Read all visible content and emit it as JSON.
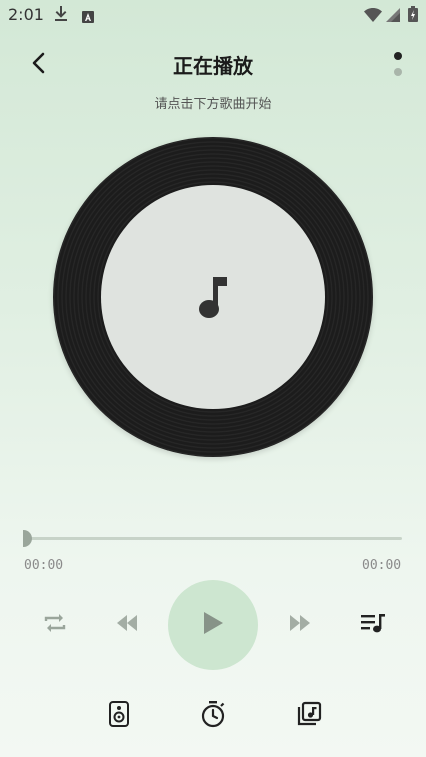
{
  "status_bar": {
    "time": "2:01",
    "icons": [
      "download-icon",
      "a-icon",
      "wifi-icon",
      "signal-icon",
      "battery-icon"
    ]
  },
  "header": {
    "title": "正在播放",
    "back_icon": "chevron-left-icon",
    "page_indicator": {
      "count": 2,
      "active_index": 0
    }
  },
  "subtitle": "请点击下方歌曲开始",
  "player": {
    "cover_icon": "music-note-icon",
    "progress": 0,
    "current_time": "00:00",
    "total_time": "00:00"
  },
  "controls": {
    "repeat_icon": "repeat-icon",
    "rewind_icon": "rewind-icon",
    "play_icon": "play-icon",
    "forward_icon": "fast-forward-icon",
    "playlist_icon": "playlist-icon"
  },
  "bottom_actions": {
    "speaker_icon": "speaker-icon",
    "timer_icon": "timer-icon",
    "library_icon": "music-library-icon"
  },
  "colors": {
    "background_top": "#d3e8d6",
    "background_bottom": "#f3f8f3",
    "play_button_bg": "#cde6d0",
    "vinyl": "#1c1c1c",
    "vinyl_label": "#dfe3df",
    "icon_muted": "#9aa59b",
    "icon_dark": "#222222"
  }
}
